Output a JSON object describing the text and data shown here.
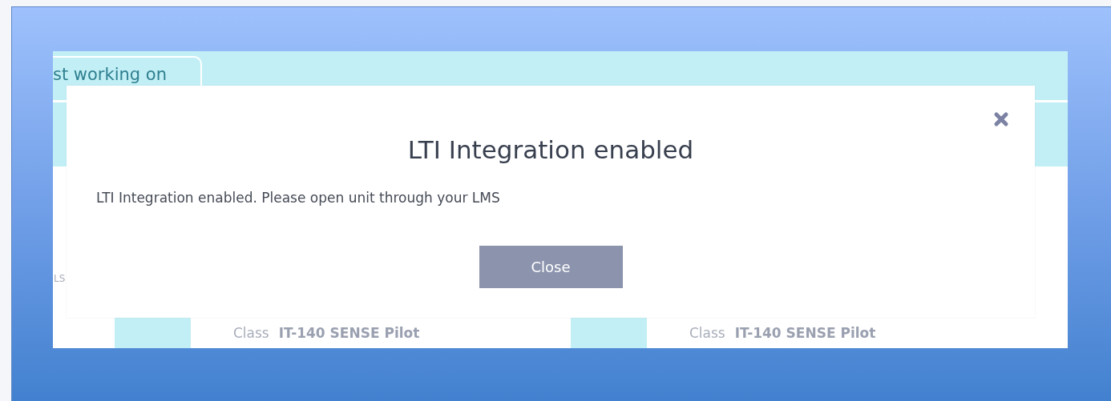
{
  "background": {
    "tab": {
      "label": "st working on"
    },
    "side_label": "LS",
    "cards": [
      {
        "field_label": "Class",
        "field_value": "IT-140 SENSE Pilot"
      },
      {
        "field_label": "Class",
        "field_value": "IT-140 SENSE Pilot"
      }
    ]
  },
  "dialog": {
    "title": "LTI Integration enabled",
    "message": "LTI Integration enabled. Please open unit through your LMS",
    "buttons": [
      "Close"
    ]
  }
}
